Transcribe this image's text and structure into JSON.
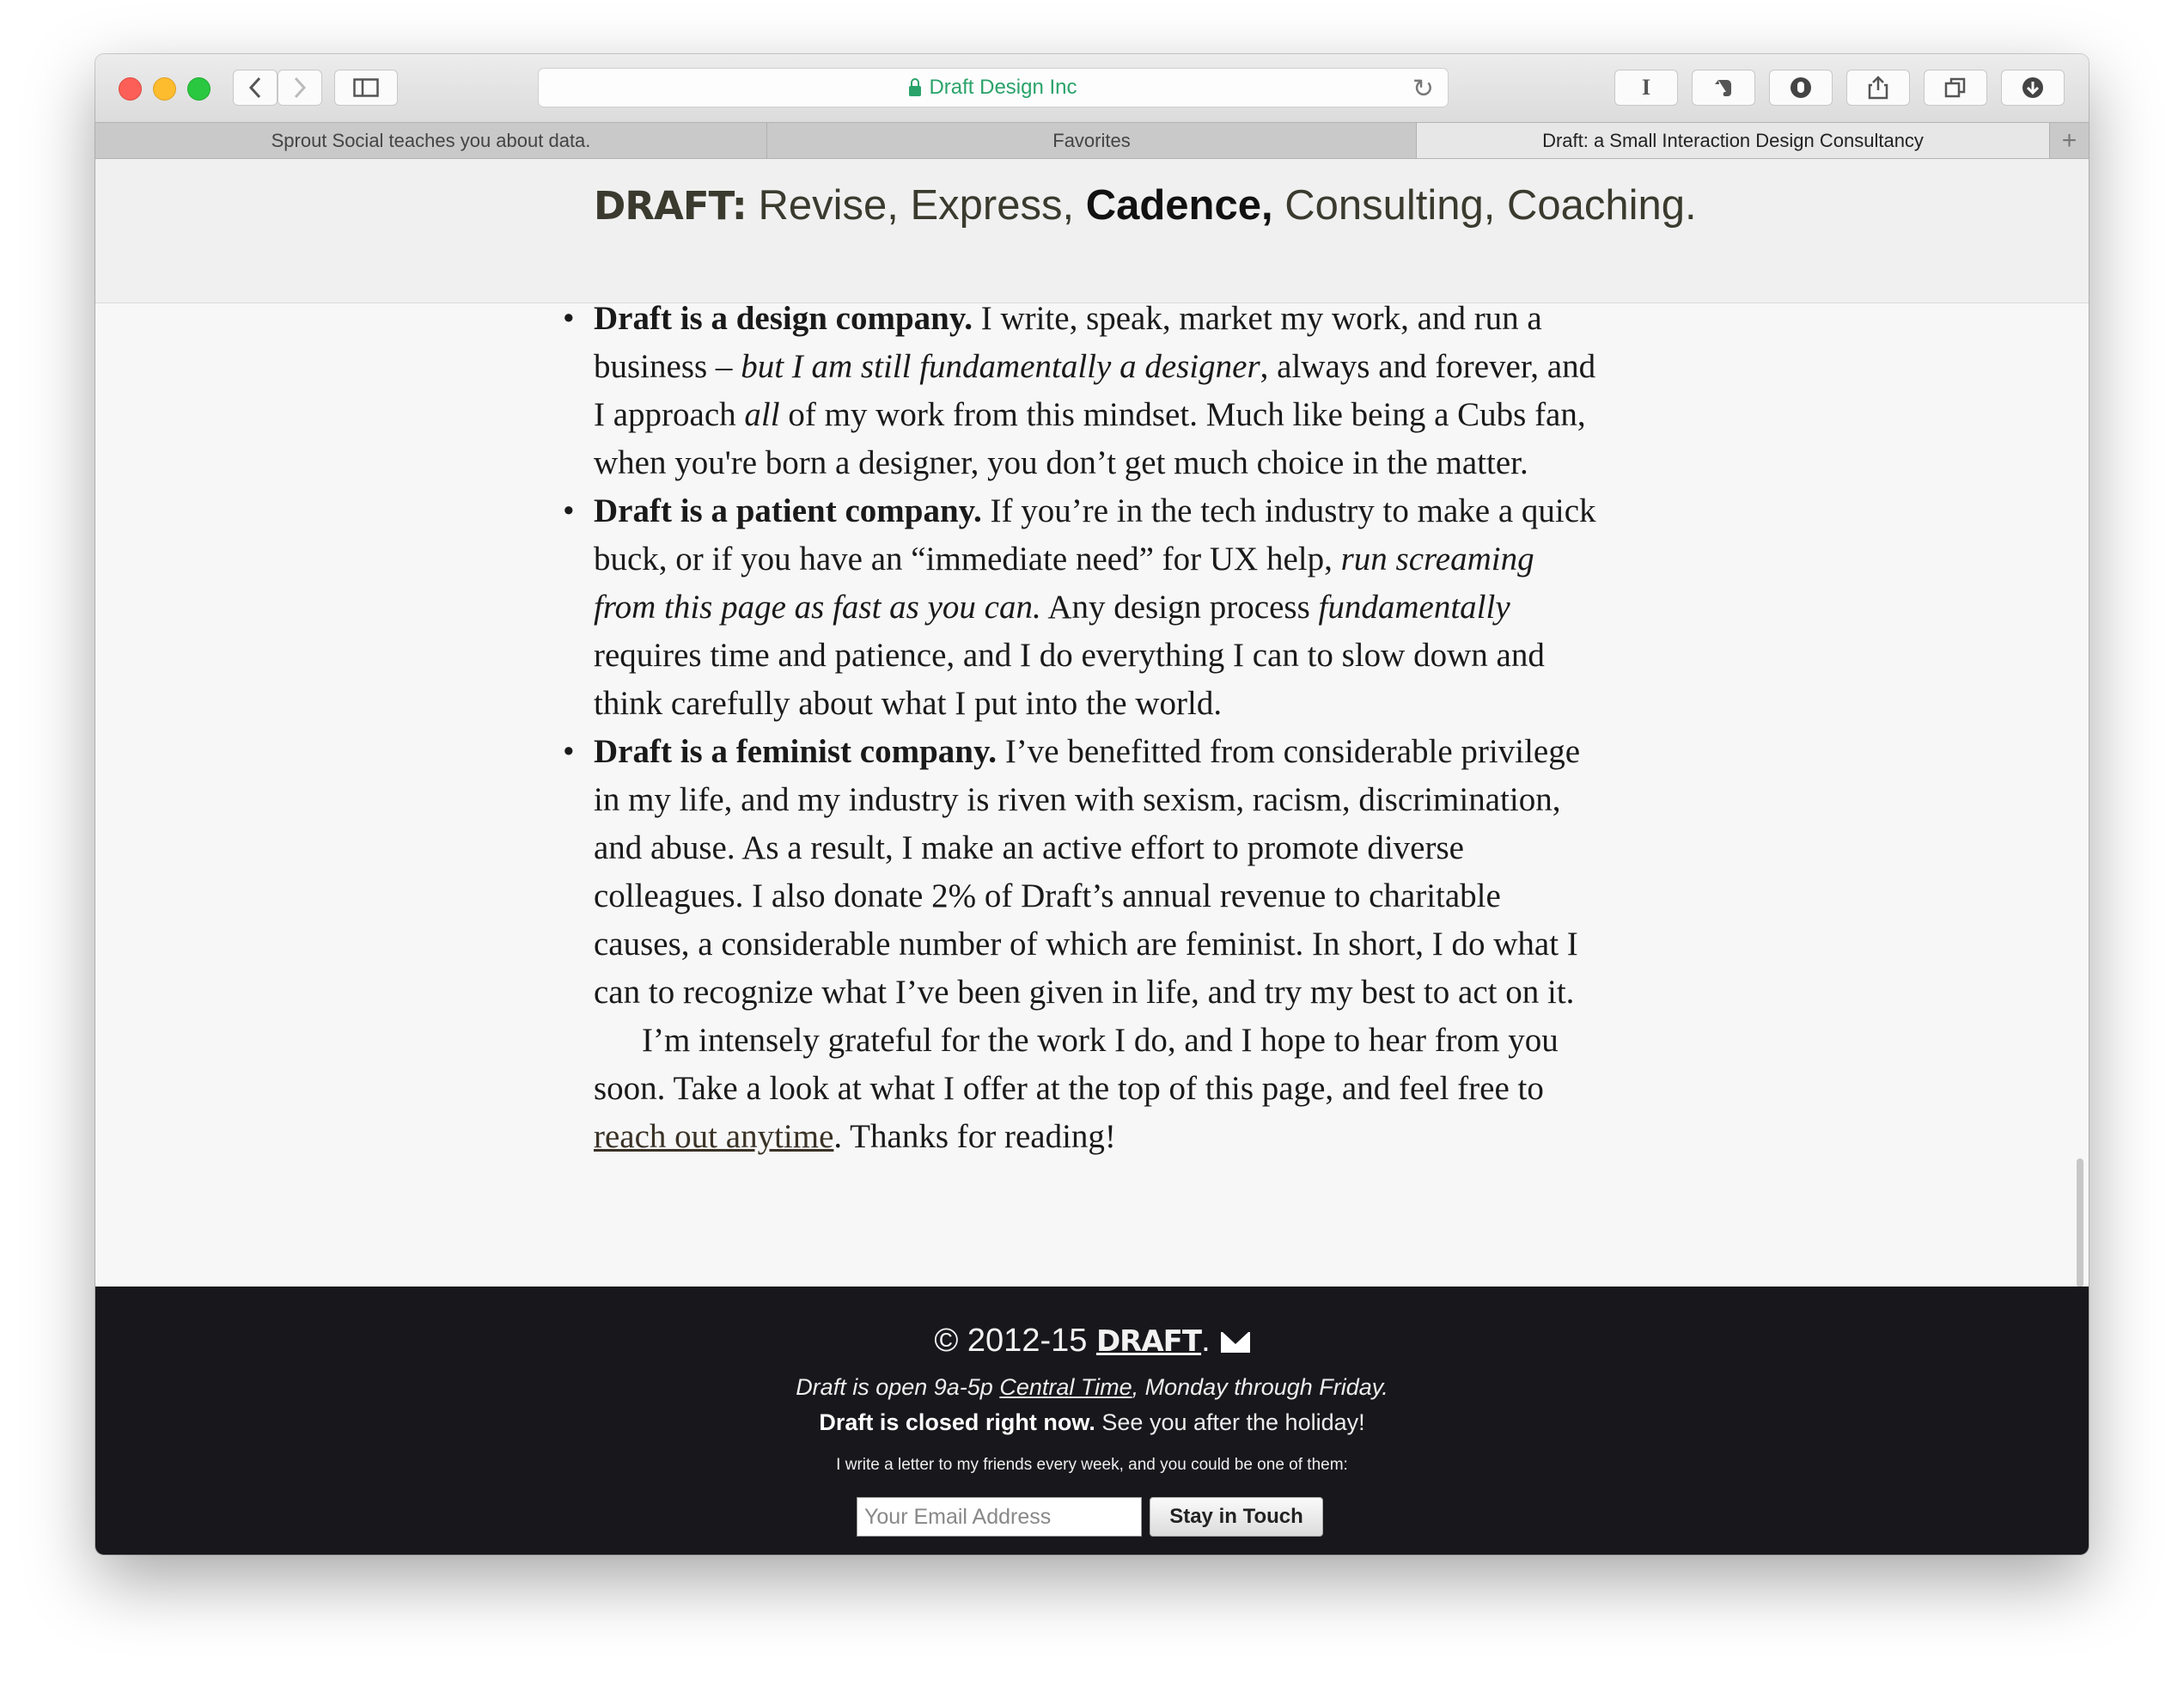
{
  "browser": {
    "address": "Draft Design Inc",
    "tabs": [
      {
        "label": "Sprout Social teaches you about data."
      },
      {
        "label": "Favorites"
      },
      {
        "label": "Draft: a Small Interaction Design Consultancy"
      }
    ],
    "reader_label": "I",
    "new_tab_label": "+"
  },
  "header": {
    "brand": "DRAFT:",
    "part1": "Revise, Express,",
    "bold": "Cadence,",
    "part2": "Consulting, Coaching."
  },
  "article": {
    "item1": {
      "lead": "Draft is a design company.",
      "t1": " I write, speak, market my work, and run a business – ",
      "em1": "but I am still fundamentally a designer",
      "t2": ", always and forever, and I approach ",
      "em2": "all",
      "t3": " of my work from this mindset. Much like being a Cubs fan, when you're born a designer, you don’t get much choice in the matter."
    },
    "item2": {
      "lead": "Draft is a patient company.",
      "t1": " If you’re in the tech industry to make a quick buck, or if you have an “immediate need” for UX help, ",
      "em1": "run screaming from this page as fast as you can.",
      "t2": " Any design process ",
      "em2": "fundamentally",
      "t3": " requires time and patience, and I do everything I can to slow down and think carefully about what I put into the world."
    },
    "item3": {
      "lead": "Draft is a feminist company.",
      "t1": " I’ve benefitted from considerable privilege in my life, and my industry is riven with sexism, racism, discrimination, and abuse. As a result, I make an active effort to promote diverse colleagues. I also donate 2% of Draft’s annual revenue to charitable causes, a considerable number of which are feminist. In short, I do what I can to recognize what I’ve been given in life, and try my best to act on it."
    },
    "closing": {
      "t1": "I’m intensely grateful for the work I do, and I hope to hear from you soon. Take a look at what I offer at the top of this page, and feel free to ",
      "link": "reach out anytime",
      "t2": ". Thanks for reading!"
    }
  },
  "footer": {
    "copyright": "© 2012-15",
    "brand": "DRAFT",
    "dot": ".",
    "hours_pre": "Draft is open 9a-5p ",
    "hours_link": "Central Time",
    "hours_post": ", Monday through Friday.",
    "closed_bold": "Draft is closed right now.",
    "closed_rest": " See you after the holiday!",
    "letter": "I write a letter to my friends every week, and you could be one of them:",
    "email_placeholder": "Your Email Address",
    "button": "Stay in Touch"
  }
}
